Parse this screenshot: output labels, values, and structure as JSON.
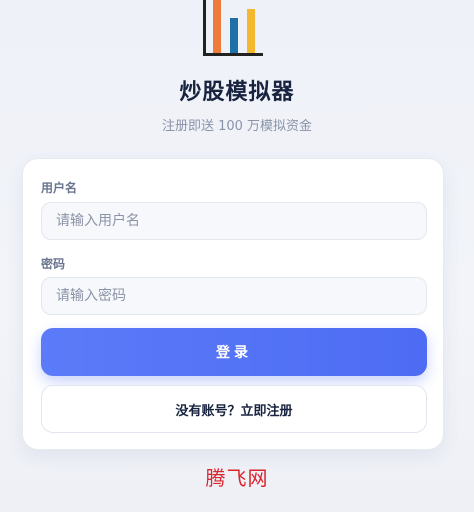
{
  "logo": {
    "icon": "bar-chart-icon",
    "bar_colors": [
      "#f07a3a",
      "#1f6fa8",
      "#f4b82e"
    ],
    "axis_color": "#222222"
  },
  "header": {
    "title": "炒股模拟器",
    "subtitle": "注册即送 100 万模拟资金"
  },
  "form": {
    "username_label": "用户名",
    "username_placeholder": "请输入用户名",
    "username_value": "",
    "password_label": "密码",
    "password_placeholder": "请输入密码",
    "password_value": "",
    "login_label": "登录",
    "register_label": "没有账号？立即注册"
  },
  "watermark": {
    "text": "腾飞网"
  },
  "colors": {
    "accent": "#4f6ef5",
    "watermark": "#d9252d"
  }
}
